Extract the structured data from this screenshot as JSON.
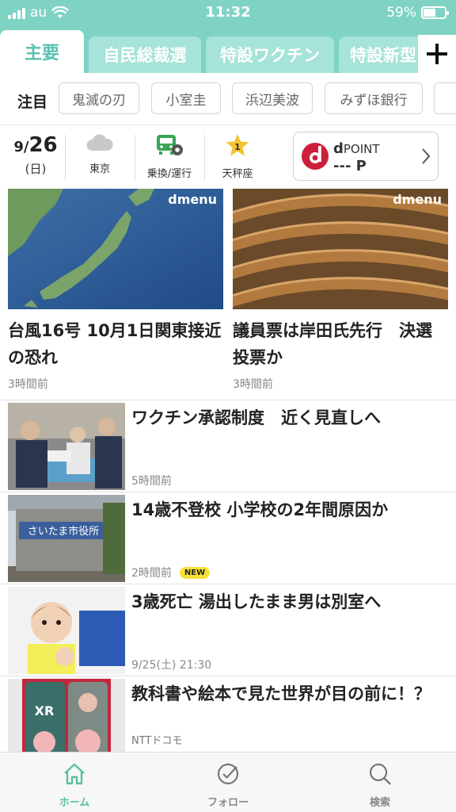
{
  "status_bar": {
    "carrier": "au",
    "time": "11:32",
    "battery": "59%",
    "battery_level": 0.59
  },
  "tabs": [
    {
      "label": "主要",
      "active": true
    },
    {
      "label": "自民総裁選"
    },
    {
      "label": "特設ワクチン"
    },
    {
      "label": "特設新型"
    }
  ],
  "add_tab_icon": "plus-icon",
  "featured": {
    "label": "注目",
    "keywords": [
      "鬼滅の刃",
      "小室圭",
      "浜辺美波",
      "みずほ銀行"
    ]
  },
  "info": {
    "date_month": "9/",
    "date_day": "26",
    "weekday": "(日)",
    "weather_label": "東京",
    "transit_label": "乗換/運行",
    "horoscope_rank": "1",
    "horoscope_label": "天秤座",
    "dpoint_title_d": "d",
    "dpoint_title_rest": "POINT",
    "dpoint_value": "--- P"
  },
  "top_articles": [
    {
      "headline": "台風16号 10月1日関東接近の恐れ",
      "time": "3時間前",
      "brand": "dmenu"
    },
    {
      "headline": "議員票は岸田氏先行　決選投票か",
      "time": "3時間前",
      "brand": "dmenu"
    }
  ],
  "articles": [
    {
      "headline": "ワクチン承認制度　近く見直しへ",
      "time": "5時間前"
    },
    {
      "headline": "14歳不登校 小学校の2年間原因か",
      "time": "2時間前",
      "badge": "NEW",
      "sign_text": "さいたま市役所"
    },
    {
      "headline": "3歳死亡 湯出したまま男は別室へ",
      "time": "9/25(土) 21:30"
    },
    {
      "headline": "教科書や絵本で見た世界が目の前に！？",
      "source": "NTTドコモ",
      "thumb_text": "XR"
    }
  ],
  "bottom_nav": [
    {
      "label": "ホーム",
      "icon": "home-icon",
      "active": true
    },
    {
      "label": "フォロー",
      "icon": "follow-check-icon"
    },
    {
      "label": "検索",
      "icon": "search-icon"
    }
  ],
  "colors": {
    "header_teal": "#7fd3c4",
    "active_green": "#5bbf9e",
    "docomo_red": "#cc1f3b",
    "new_badge": "#f6df3a"
  }
}
